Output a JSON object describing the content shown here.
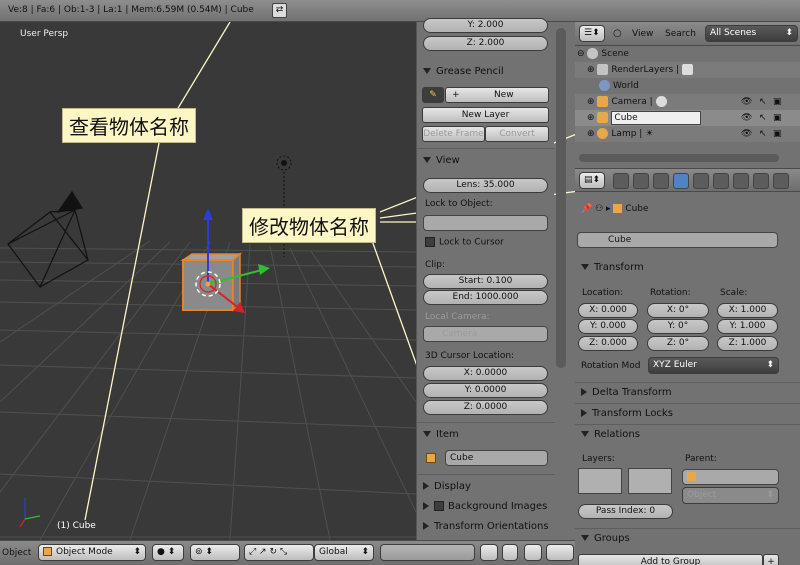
{
  "topbar": {
    "stats": "Ve:8 | Fa:6 | Ob:1-3 | La:1 | Mem:6.59M (0.54M) | Cube"
  },
  "viewport": {
    "title": "User Persp",
    "object_label": "(1) Cube"
  },
  "annotations": {
    "view_name": "查看物体名称",
    "edit_name": "修改物体名称"
  },
  "viewport_header": {
    "menu_label": "Object",
    "mode": "Object Mode",
    "orientation": "Global"
  },
  "toolshelf": {
    "loc_y": "Y: 2.000",
    "loc_z": "Z: 2.000",
    "grease_pencil": {
      "title": "Grease Pencil",
      "new": "New",
      "new_layer": "New Layer",
      "delete_frame": "Delete Frame",
      "convert": "Convert"
    },
    "view": {
      "title": "View",
      "lens": "Lens: 35.000",
      "lock_to_object": "Lock to Object:",
      "lock_to_cursor": "Lock to Cursor",
      "clip": "Clip:",
      "clip_start": "Start: 0.100",
      "clip_end": "End: 1000.000",
      "local_camera": "Local Camera:",
      "camera": "Camera",
      "cursor_location": "3D Cursor Location:",
      "cursor_x": "X: 0.0000",
      "cursor_y": "Y: 0.0000",
      "cursor_z": "Z: 0.0000"
    },
    "item": {
      "title": "Item",
      "name": "Cube"
    },
    "collapsed": [
      "Display",
      "Background Images",
      "Transform Orientations"
    ]
  },
  "outliner": {
    "menus": [
      "View",
      "Search"
    ],
    "scene_select": "All Scenes",
    "rows": [
      {
        "label": "Scene"
      },
      {
        "label": "RenderLayers"
      },
      {
        "label": "World"
      },
      {
        "label": "Camera"
      },
      {
        "label": "Cube"
      },
      {
        "label": "Lamp"
      }
    ]
  },
  "properties": {
    "breadcrumb_object": "Cube",
    "object_name": "Cube",
    "transform": {
      "title": "Transform",
      "location_label": "Location:",
      "rotation_label": "Rotation:",
      "scale_label": "Scale:",
      "loc": [
        "X: 0.000",
        "Y: 0.000",
        "Z: 0.000"
      ],
      "rot": [
        "X: 0°",
        "Y: 0°",
        "Z: 0°"
      ],
      "scale": [
        "X: 1.000",
        "Y: 1.000",
        "Z: 1.000"
      ],
      "rotation_mode_label": "Rotation Mod",
      "rotation_mode": "XYZ Euler"
    },
    "delta_transform": "Delta Transform",
    "transform_locks": "Transform Locks",
    "relations": {
      "title": "Relations",
      "layers": "Layers:",
      "parent": "Parent:",
      "parent_type": "Object",
      "pass_index": "Pass Index: 0"
    },
    "groups": {
      "title": "Groups",
      "add_to_group": "Add to Group"
    }
  }
}
